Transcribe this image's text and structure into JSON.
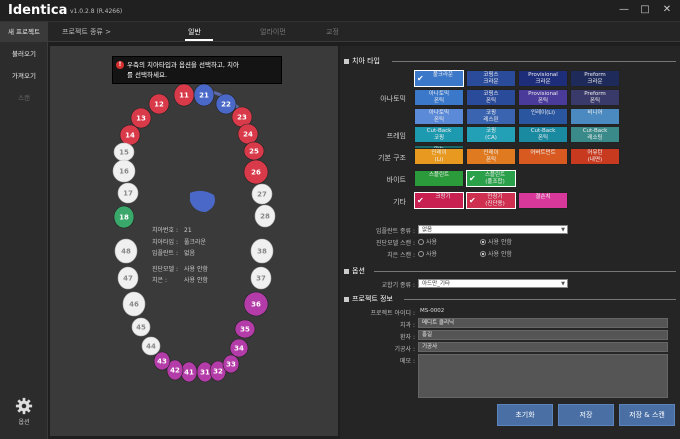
{
  "app": {
    "logo": "Identica",
    "version": "v1.0.2.8 (R.4266)"
  },
  "window": {
    "min": "—",
    "max": "□",
    "close": "✕"
  },
  "sidebar": {
    "items": [
      {
        "label": "새 프로젝트",
        "state": "active"
      },
      {
        "label": "불러오기",
        "state": "normal"
      },
      {
        "label": "가져오기",
        "state": "normal"
      },
      {
        "label": "스캔",
        "state": "disabled"
      }
    ],
    "settings_label": "옵션"
  },
  "nav": {
    "breadcrumb": "프로젝트 종류 >",
    "tabs": [
      {
        "label": "일반",
        "active": true
      },
      {
        "label": "얼라이먼",
        "active": false
      },
      {
        "label": "교정",
        "active": false
      }
    ]
  },
  "tooltip": {
    "icon": "!",
    "line1": "우측의 치아타입과 옵션을 선택하고, 치아",
    "line2": "를 선택하세요."
  },
  "teeth": [
    {
      "num": "11",
      "color": "#d93a4a"
    },
    {
      "num": "12",
      "color": "#d93a4a"
    },
    {
      "num": "13",
      "color": "#d93a4a"
    },
    {
      "num": "14",
      "color": "#d93a4a"
    },
    {
      "num": "15",
      "color": "#f0f0f0"
    },
    {
      "num": "16",
      "color": "#f0f0f0"
    },
    {
      "num": "17",
      "color": "#f0f0f0"
    },
    {
      "num": "18",
      "color": "#3aa86a"
    },
    {
      "num": "21",
      "color": "#4a68c8"
    },
    {
      "num": "22",
      "color": "#4a68c8"
    },
    {
      "num": "23",
      "color": "#d93a4a"
    },
    {
      "num": "24",
      "color": "#d93a4a"
    },
    {
      "num": "25",
      "color": "#d93a4a"
    },
    {
      "num": "26",
      "color": "#d93a4a"
    },
    {
      "num": "27",
      "color": "#f0f0f0"
    },
    {
      "num": "28",
      "color": "#f0f0f0"
    },
    {
      "num": "31",
      "color": "#b43ca8"
    },
    {
      "num": "32",
      "color": "#b43ca8"
    },
    {
      "num": "33",
      "color": "#b43ca8"
    },
    {
      "num": "34",
      "color": "#b43ca8"
    },
    {
      "num": "35",
      "color": "#b43ca8"
    },
    {
      "num": "36",
      "color": "#b43ca8"
    },
    {
      "num": "37",
      "color": "#f0f0f0"
    },
    {
      "num": "38",
      "color": "#f0f0f0"
    },
    {
      "num": "41",
      "color": "#b43ca8"
    },
    {
      "num": "42",
      "color": "#b43ca8"
    },
    {
      "num": "43",
      "color": "#b43ca8"
    },
    {
      "num": "44",
      "color": "#f0f0f0"
    },
    {
      "num": "45",
      "color": "#f0f0f0"
    },
    {
      "num": "46",
      "color": "#f0f0f0"
    },
    {
      "num": "47",
      "color": "#f0f0f0"
    },
    {
      "num": "48",
      "color": "#f0f0f0"
    }
  ],
  "tooth_info": [
    {
      "label": "치아번호 :",
      "value": "21"
    },
    {
      "label": "치아타입 :",
      "value": "풀크라운"
    },
    {
      "label": "임플란트 :",
      "value": "없음"
    },
    {
      "label": "진단모델 :",
      "value": "사용 안함"
    },
    {
      "label": "치은 :",
      "value": "사용 안함"
    }
  ],
  "sections": {
    "tooth_type": "치아 타입",
    "options": "옵션",
    "project_info": "프로젝트 정보"
  },
  "tooth_type_rows": [
    {
      "label": "아나토믹",
      "buttons": [
        {
          "text": "풀크라운",
          "color": "#3b78c9",
          "checked": true
        },
        {
          "text": "코핑스\n크라운",
          "color": "#2a4a9a",
          "checked": false
        },
        {
          "text": "Provisional\n크라운",
          "color": "#1e2d7a",
          "checked": false
        },
        {
          "text": "Preform\n크라운",
          "color": "#1e2a5a",
          "checked": false
        },
        {
          "text": "아나토믹\n폰틱",
          "color": "#3b78c9",
          "checked": false
        },
        {
          "text": "코핑스\n폰틱",
          "color": "#2a4a9a",
          "checked": false
        },
        {
          "text": "Provisional\n폰틱",
          "color": "#4a3a9a",
          "checked": false
        },
        {
          "text": "Preform\n폰틱",
          "color": "#3a3a6a",
          "checked": false
        },
        {
          "text": "아나토믹\n폰틱",
          "color": "#5b8ad8",
          "checked": false
        },
        {
          "text": "코핑\n레스핀",
          "color": "#3a64b0",
          "checked": false
        },
        {
          "text": "인레이(Li)",
          "color": "#2a56a0",
          "checked": false
        },
        {
          "text": "비니어",
          "color": "#4a8ac0",
          "checked": false
        }
      ]
    },
    {
      "label": "프레임",
      "buttons": [
        {
          "text": "Cut-Back\n코핑",
          "color": "#1e9ab0",
          "checked": false
        },
        {
          "text": "코핑\n(CA)",
          "color": "#23a0b5",
          "checked": false
        },
        {
          "text": "Cut-Back\n폰틱",
          "color": "#1a8aa0",
          "checked": false
        },
        {
          "text": "Cut-Back\n레소팅",
          "color": "#3a8a8a",
          "checked": false
        },
        {
          "text": "양능\n인레이",
          "color": "#1a6a6a",
          "checked": false
        }
      ]
    },
    {
      "label": "기본 구조",
      "buttons": [
        {
          "text": "인레이\n(Li)",
          "color": "#e89a20",
          "checked": false
        },
        {
          "text": "인레이\n폰틱",
          "color": "#e07a20",
          "checked": false
        },
        {
          "text": "어버트먼트",
          "color": "#d85a20",
          "checked": false
        },
        {
          "text": "어뮤턴\n(내면)",
          "color": "#c83a20",
          "checked": false
        }
      ]
    },
    {
      "label": "바이트",
      "buttons": [
        {
          "text": "스플린트",
          "color": "#2a9a3a",
          "checked": false
        },
        {
          "text": "스플린트\n(풀조합)",
          "color": "#2aa04a",
          "checked": true
        }
      ]
    },
    {
      "label": "기타",
      "buttons": [
        {
          "text": "크랑기",
          "color": "#c82050",
          "checked": true
        },
        {
          "text": "인장기\n(진단용)",
          "color": "#d03050",
          "checked": true
        },
        {
          "text": "결손치",
          "color": "#d8389a",
          "checked": false
        }
      ]
    }
  ],
  "implant": {
    "type_label": "임플란트 종류 :",
    "type_value": "없음",
    "diag_label": "진단모델 스캔 :",
    "gum_label": "치은 스캔 :",
    "use": "사용",
    "not_use": "사용 안함"
  },
  "options": {
    "label": "교합기 종류 :",
    "value": "아드만_기타"
  },
  "project": {
    "id_label": "프로젝트 아이디 :",
    "id_value": "MS-0002",
    "clinic_label": "치과 :",
    "clinic_value": "메디트 클리닉",
    "patient_label": "환자 :",
    "patient_value": "홍길",
    "tech_label": "기공사 :",
    "tech_value": "기공사",
    "memo_label": "메모 :"
  },
  "actions": {
    "reset": "초기화",
    "save": "저장",
    "save_scan": "저장 & 스캔"
  }
}
